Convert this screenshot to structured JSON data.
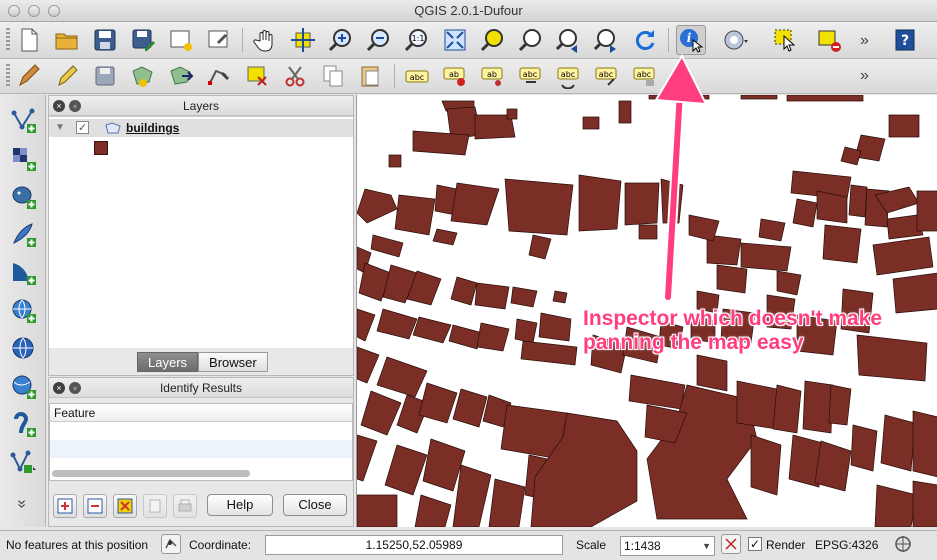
{
  "window": {
    "title": "QGIS 2.0.1-Dufour"
  },
  "colors": {
    "building_fill": "#7a2e26",
    "building_stroke": "#2a0d0a",
    "annotation": "#ff3d7f"
  },
  "toolbar1": {
    "icons": [
      "new-project-icon",
      "open-project-icon",
      "save-project-icon",
      "save-as-icon",
      "new-print-composer-icon",
      "composer-manager-icon",
      "pan-icon",
      "pan-to-selection-icon",
      "zoom-in-icon",
      "zoom-out-icon",
      "zoom-actual-size-icon",
      "zoom-full-icon",
      "zoom-to-selection-icon",
      "zoom-to-layer-icon",
      "zoom-last-icon",
      "zoom-next-icon",
      "refresh-icon",
      "identify-features-icon",
      "action-icon",
      "select-features-icon",
      "deselect-all-icon",
      "help-icon"
    ],
    "overflow_label": "»"
  },
  "toolbar2": {
    "icons": [
      "current-edits-icon",
      "toggle-editing-icon",
      "save-layer-edits-icon",
      "add-feature-icon",
      "move-feature-icon",
      "node-tool-icon",
      "delete-selected-icon",
      "cut-features-icon",
      "copy-features-icon",
      "paste-features-icon",
      "label-tool-icon",
      "pin-labels-icon",
      "show-hide-labels-icon",
      "move-label-icon",
      "rotate-label-icon",
      "change-label-icon",
      "label-properties-icon"
    ],
    "overflow_label": "»"
  },
  "left_toolbar": {
    "icons": [
      "add-vector-layer-icon",
      "add-raster-layer-icon",
      "add-postgis-layer-icon",
      "add-spatialite-layer-icon",
      "add-mssql-layer-icon",
      "add-wms-layer-icon",
      "add-wcs-layer-icon",
      "add-wfs-layer-icon",
      "add-delimited-text-icon",
      "new-shapefile-icon"
    ],
    "overflow_label": "»"
  },
  "layers_panel": {
    "title": "Layers",
    "layers": [
      {
        "name": "buildings",
        "checked": true
      }
    ]
  },
  "panel_tabs": [
    {
      "label": "Layers",
      "active": true
    },
    {
      "label": "Browser",
      "active": false
    }
  ],
  "identify_panel": {
    "title": "Identify Results",
    "column_header": "Feature",
    "buttons": {
      "help": "Help",
      "close": "Close"
    }
  },
  "status": {
    "message": "No features at this position",
    "coordinate_label": "Coordinate:",
    "coordinate_value": "1.15250,52.05989",
    "scale_label": "Scale",
    "scale_value": "1:1438",
    "render_label": "Render",
    "render_checked": true,
    "crs": "EPSG:4326"
  },
  "annotation": {
    "text": "Inspector which doesn't make panning the map easy"
  }
}
